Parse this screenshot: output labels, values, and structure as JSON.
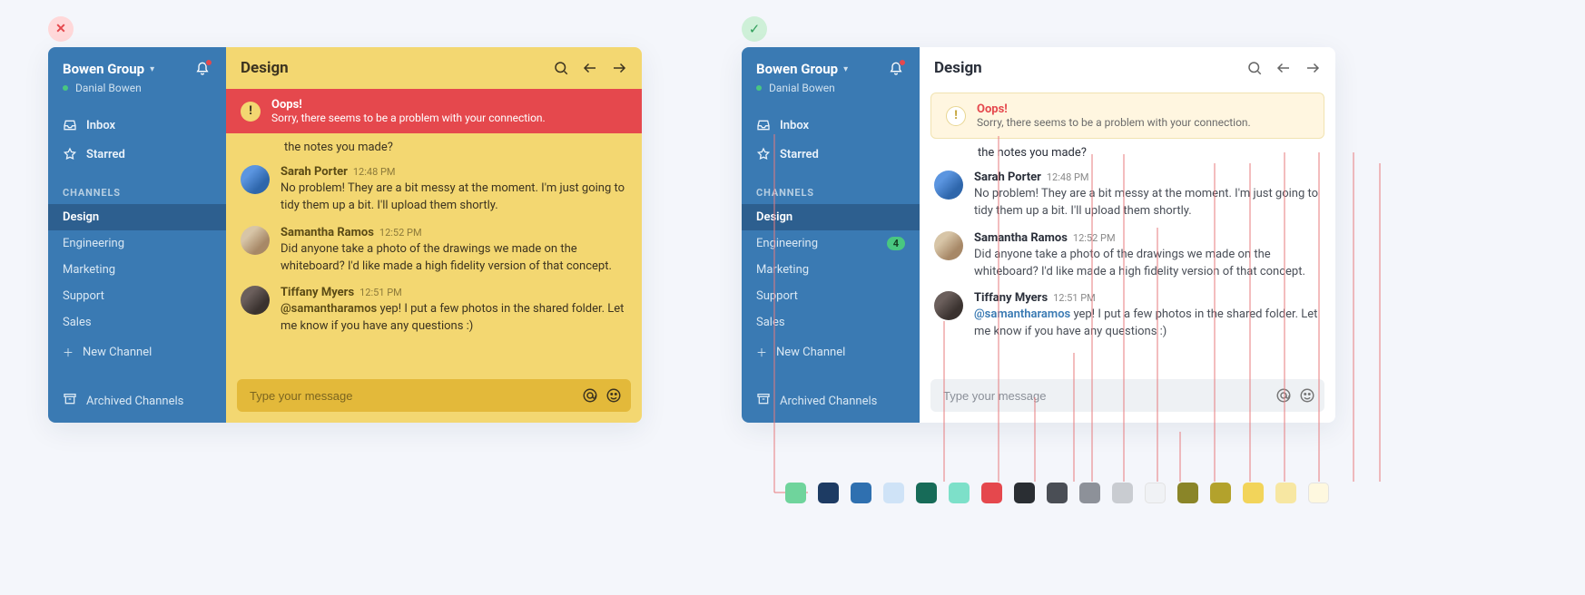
{
  "indicator": {
    "bad_symbol": "✕",
    "good_symbol": "✓"
  },
  "sidebar": {
    "group_name": "Bowen Group",
    "user_name": "Danial Bowen",
    "nav": {
      "inbox": "Inbox",
      "starred": "Starred"
    },
    "channels_header": "CHANNELS",
    "channels": [
      {
        "label": "Design",
        "active": true,
        "badge": null
      },
      {
        "label": "Engineering",
        "active": false,
        "badge": "4"
      },
      {
        "label": "Marketing",
        "active": false,
        "badge": null
      },
      {
        "label": "Support",
        "active": false,
        "badge": null
      },
      {
        "label": "Sales",
        "active": false,
        "badge": null
      }
    ],
    "new_channel": "New Channel",
    "archived": "Archived Channels"
  },
  "main": {
    "channel_title": "Design",
    "alert": {
      "title": "Oops!",
      "subtitle": "Sorry, there seems to be a problem with your connection.",
      "badge_glyph": "!"
    },
    "fragment_line": "the notes you made?",
    "messages": [
      {
        "name": "Sarah Porter",
        "time": "12:48 PM",
        "text": "No problem! They are a bit messy at the moment. I'm just going to tidy them up a bit. I'll upload them shortly.",
        "avatar": "av-blue"
      },
      {
        "name": "Samantha Ramos",
        "time": "12:52 PM",
        "text": "Did anyone take a photo of the drawings we made on the whiteboard? I'd like made a high fidelity version of that concept.",
        "avatar": "av-tan"
      },
      {
        "name": "Tiffany Myers",
        "time": "12:51 PM",
        "mention": "@samantharamos",
        "text": " yep! I put a few photos in the shared folder. Let me know if you have any questions :)",
        "avatar": "av-dark"
      }
    ],
    "composer_placeholder": "Type your message"
  },
  "palette": [
    "#6fd49c",
    "#1d3b63",
    "#2f70b0",
    "#cfe3f7",
    "#176b58",
    "#7de0c9",
    "#e5484d",
    "#2a2e33",
    "#4a4e55",
    "#8d9199",
    "#c9ccd1",
    "#f0f2f5",
    "#8a8528",
    "#b3a22c",
    "#f2d45a",
    "#f7e7a2",
    "#fef8df"
  ]
}
